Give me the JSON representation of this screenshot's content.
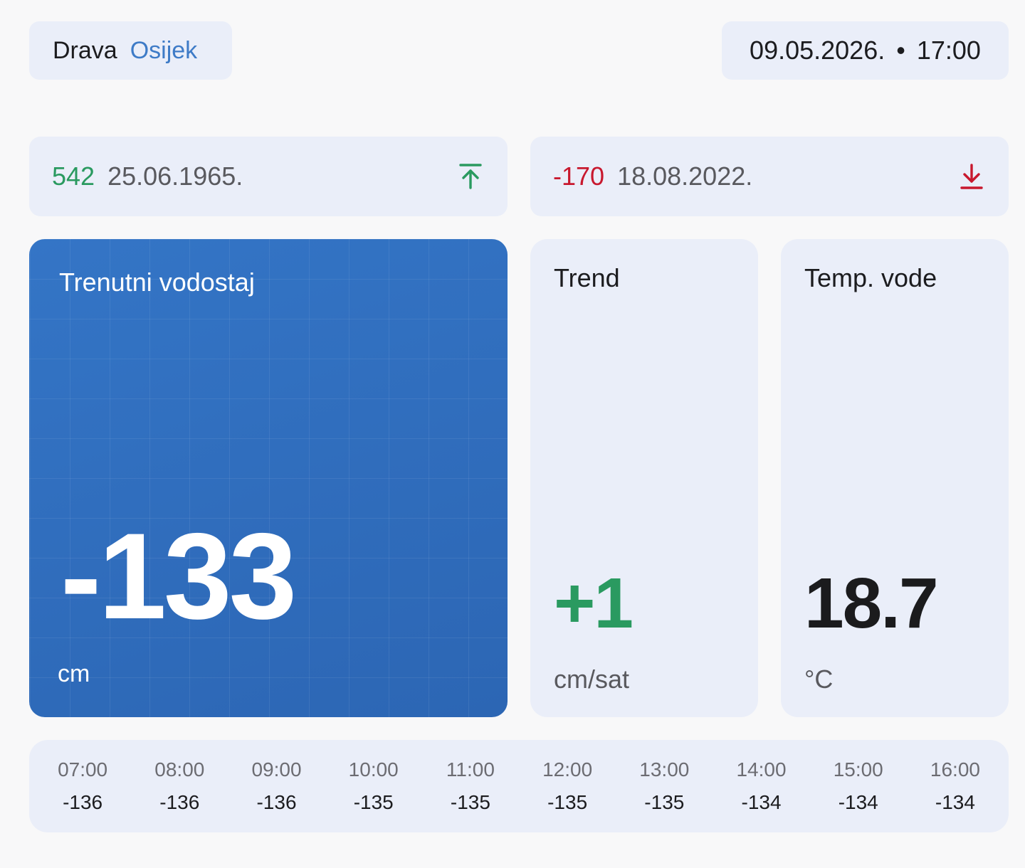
{
  "header": {
    "river": "Drava",
    "city": "Osijek",
    "date": "09.05.2026.",
    "separator": "•",
    "time": "17:00"
  },
  "records": {
    "high": {
      "value": "542",
      "date": "25.06.1965.",
      "icon": "arrow-up-to-line-icon",
      "color": "#2a9a60"
    },
    "low": {
      "value": "-170",
      "date": "18.08.2022.",
      "icon": "arrow-down-to-line-icon",
      "color": "#c8182e"
    }
  },
  "current": {
    "label": "Trenutni vodostaj",
    "value": "-133",
    "unit": "cm"
  },
  "trend": {
    "label": "Trend",
    "value": "+1",
    "unit": "cm/sat"
  },
  "water_temp": {
    "label": "Temp. vode",
    "value": "18.7",
    "unit": "°C"
  },
  "history": [
    {
      "time": "07:00",
      "level": "-136"
    },
    {
      "time": "08:00",
      "level": "-136"
    },
    {
      "time": "09:00",
      "level": "-136"
    },
    {
      "time": "10:00",
      "level": "-135"
    },
    {
      "time": "11:00",
      "level": "-135"
    },
    {
      "time": "12:00",
      "level": "-135"
    },
    {
      "time": "13:00",
      "level": "-135"
    },
    {
      "time": "14:00",
      "level": "-134"
    },
    {
      "time": "15:00",
      "level": "-134"
    },
    {
      "time": "16:00",
      "level": "-134"
    }
  ],
  "colors": {
    "accent_blue": "#3475c6",
    "positive": "#2a9a60",
    "negative": "#c8182e",
    "card_bg": "#eaeef9"
  }
}
